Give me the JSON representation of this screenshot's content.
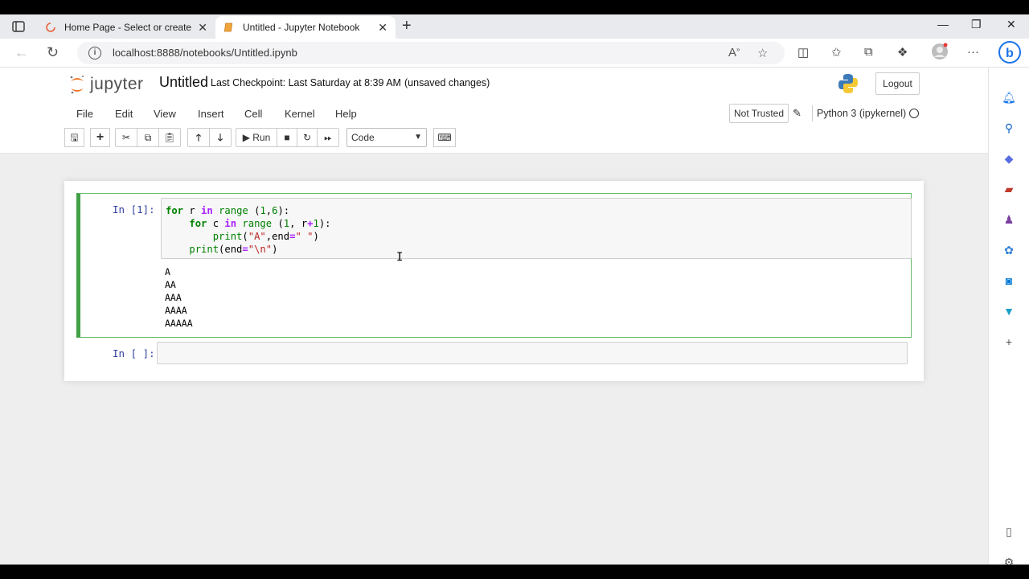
{
  "browser": {
    "tabs": [
      {
        "title": "Home Page - Select or create a n",
        "close": "✕"
      },
      {
        "title": "Untitled - Jupyter Notebook",
        "close": "✕"
      }
    ],
    "new_tab": "+",
    "window_controls": {
      "minimize": "—",
      "restore": "❐",
      "close": "✕"
    },
    "url": "localhost:8888/notebooks/Untitled.ipynb"
  },
  "jupyter": {
    "logo_text": "jupyter",
    "notebook_title": "Untitled",
    "checkpoint": "Last Checkpoint: Last Saturday at 8:39 AM",
    "unsaved": "(unsaved changes)",
    "logout": "Logout",
    "menu": [
      "File",
      "Edit",
      "View",
      "Insert",
      "Cell",
      "Kernel",
      "Help"
    ],
    "trust": "Not Trusted",
    "kernel": "Python 3 (ipykernel)",
    "toolbar": {
      "run_label": "Run",
      "cell_type": "Code"
    },
    "cells": [
      {
        "prompt": "In [1]:",
        "code_lines": [
          "for r in range (1,6):",
          "    for c in range (1, r+1):",
          "        print(\"A\",end=\" \")",
          "    print(end=\"\\n\")"
        ],
        "output": [
          "A",
          "AA",
          "AAA",
          "AAAA",
          "AAAAA"
        ]
      },
      {
        "prompt": "In [ ]:",
        "code_lines": [],
        "output": []
      }
    ]
  },
  "colors": {
    "accent": "#f37726",
    "selected_cell": "#42a047",
    "prompt": "#303f9f"
  }
}
